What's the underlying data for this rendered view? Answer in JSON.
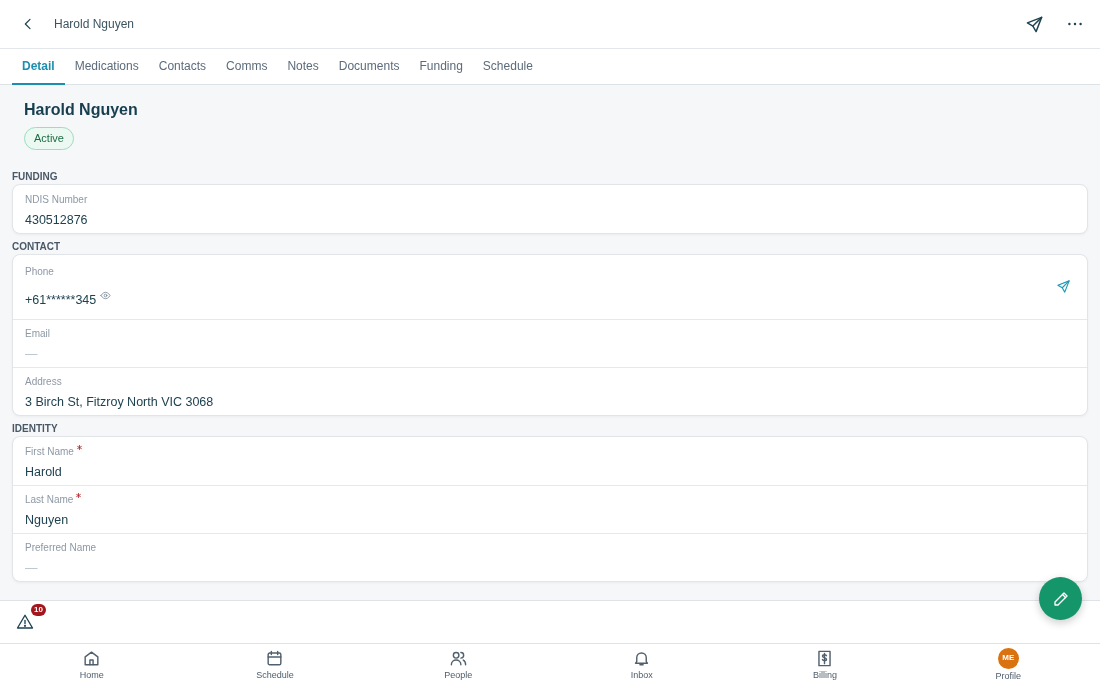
{
  "header": {
    "title": "Harold Nguyen"
  },
  "tabs": [
    {
      "label": "Detail",
      "selected": true
    },
    {
      "label": "Medications",
      "selected": false
    },
    {
      "label": "Contacts",
      "selected": false
    },
    {
      "label": "Comms",
      "selected": false
    },
    {
      "label": "Notes",
      "selected": false
    },
    {
      "label": "Documents",
      "selected": false
    },
    {
      "label": "Funding",
      "selected": false
    },
    {
      "label": "Schedule",
      "selected": false
    }
  ],
  "profile": {
    "name": "Harold Nguyen",
    "status": "Active"
  },
  "sections": [
    {
      "title": "FUNDING",
      "fields": [
        {
          "label": "NDIS Number",
          "value": "430512876",
          "required": false,
          "empty": false
        }
      ]
    },
    {
      "title": "CONTACT",
      "fields": [
        {
          "label": "Phone",
          "value": "+61******345",
          "required": false,
          "empty": false,
          "masked": true,
          "kind": "phone"
        },
        {
          "label": "Email",
          "value": "—",
          "required": false,
          "empty": true
        },
        {
          "label": "Address",
          "value": "3 Birch St, Fitzroy North VIC 3068",
          "required": false,
          "empty": false
        }
      ]
    },
    {
      "title": "IDENTITY",
      "fields": [
        {
          "label": "First Name",
          "value": "Harold",
          "required": true,
          "empty": false
        },
        {
          "label": "Last Name",
          "value": "Nguyen",
          "required": true,
          "empty": false
        },
        {
          "label": "Preferred Name",
          "value": "—",
          "required": false,
          "empty": true
        }
      ]
    }
  ],
  "alerts": {
    "count": "10"
  },
  "bottom_nav": [
    {
      "label": "Home"
    },
    {
      "label": "Schedule"
    },
    {
      "label": "People"
    },
    {
      "label": "Inbox"
    },
    {
      "label": "Billing"
    },
    {
      "label": "Profile",
      "initials": "ME"
    }
  ]
}
